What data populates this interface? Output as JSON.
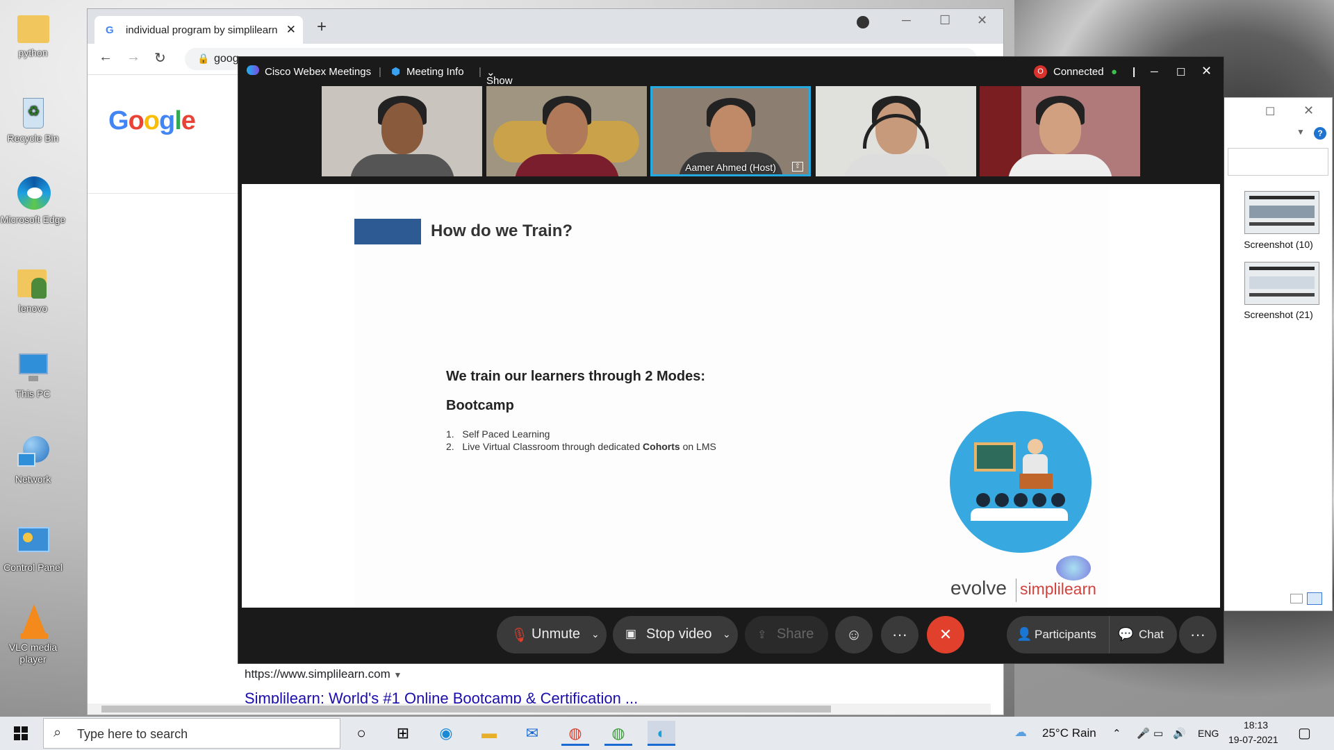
{
  "desktop_icons": [
    {
      "label": "python",
      "icon": "folder-icon"
    },
    {
      "label": "Recycle Bin",
      "icon": "recycle-bin-icon"
    },
    {
      "label": "Microsoft Edge",
      "icon": "edge-icon"
    },
    {
      "label": "lenovo",
      "icon": "user-folder-icon"
    },
    {
      "label": "This PC",
      "icon": "computer-icon"
    },
    {
      "label": "Network",
      "icon": "network-icon"
    },
    {
      "label": "Control Panel",
      "icon": "control-panel-icon"
    },
    {
      "label": "VLC media player",
      "icon": "vlc-icon"
    }
  ],
  "chrome": {
    "tab_title": "individual program by simplilearn",
    "tab_close": "✕",
    "new_tab": "+",
    "omnibox": "goog",
    "google_logo": "Google",
    "result_url": "https://www.simplilearn.com",
    "result_title": "Simplilearn: World's #1 Online Bootcamp & Certification ..."
  },
  "webex": {
    "app_name": "Cisco Webex Meetings",
    "meeting_info": "Meeting Info",
    "show_menu_bar": "Show Menu Bar",
    "connected": "Connected",
    "host_label": "Aamer Ahmed  (Host)",
    "slide": {
      "title": "How do we Train?",
      "heading": "We train our learners through 2 Modes:",
      "subheading": "Bootcamp",
      "items": [
        {
          "num": "1.",
          "pre": "Self Paced Learning",
          "bold": "",
          "post": ""
        },
        {
          "num": "2.",
          "pre": "Live Virtual Classroom through dedicated ",
          "bold": "Cohorts",
          "post": " on LMS"
        }
      ],
      "logo_left": "evolve",
      "logo_right": "simplilearn"
    },
    "controls": {
      "unmute": "Unmute",
      "stop_video": "Stop video",
      "share": "Share",
      "participants": "Participants",
      "chat": "Chat",
      "more": "···"
    }
  },
  "explorer": {
    "thumbs": [
      {
        "label": "Screenshot (10)"
      },
      {
        "label": "Screenshot (21)"
      }
    ]
  },
  "taskbar": {
    "search_placeholder": "Type here to search",
    "weather": "25°C  Rain",
    "lang": "ENG",
    "time": "18:13",
    "date": "19-07-2021"
  },
  "colors": {
    "accent_blue": "#2e5a94",
    "end_red": "#e0402c",
    "webex_bg": "#1a1a1a",
    "link": "#1a0dab"
  }
}
